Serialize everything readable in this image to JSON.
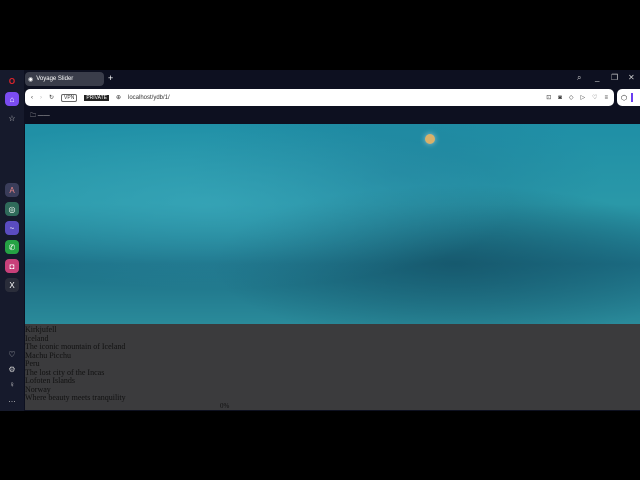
{
  "browser": {
    "tab_title": "Voyage Slider",
    "url": "localhost/ydb/1/",
    "vpn": "VPN",
    "private": "PRIVATE",
    "bookmark": "——"
  },
  "slides": [
    {
      "title": "Kirkjufell",
      "country": "Iceland",
      "caption": "The iconic mountain of Iceland"
    },
    {
      "title": "Machu Picchu",
      "country": "Peru",
      "caption": "The lost city of the Incas"
    },
    {
      "title": "Lofoten Islands",
      "country": "Norway",
      "caption": "Where beauty meets tranquility"
    }
  ],
  "progress": "0%"
}
